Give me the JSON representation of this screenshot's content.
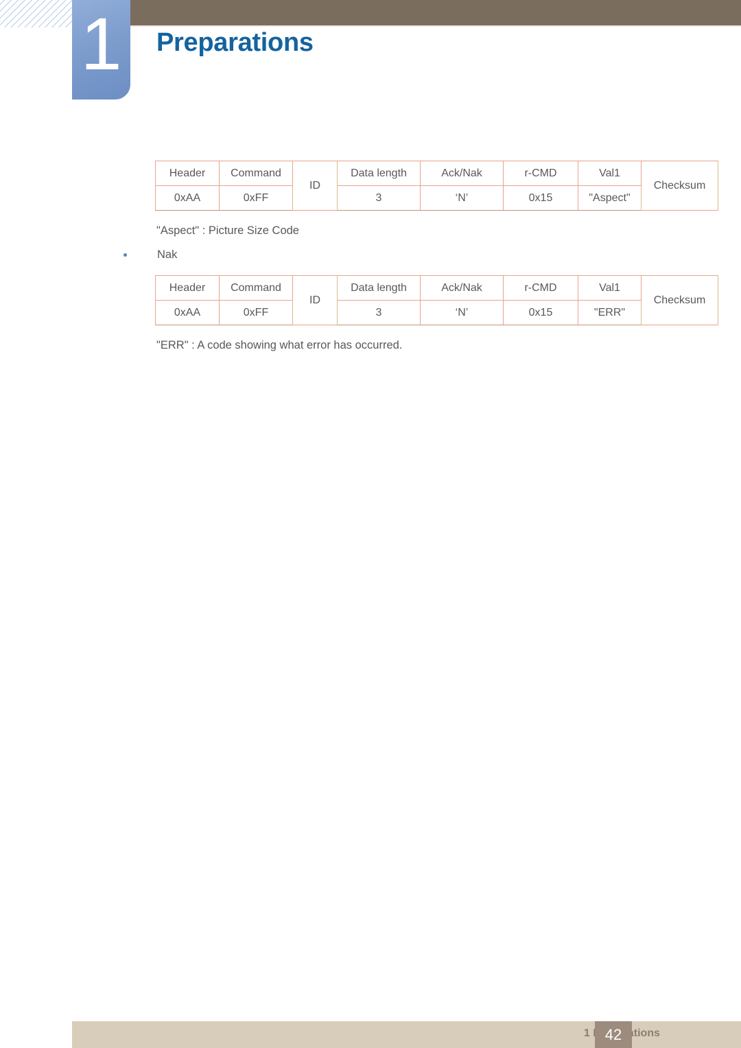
{
  "header": {
    "chapter_number": "1",
    "chapter_title": "Preparations",
    "bar_color": "#7a6d5e",
    "badge_color": "#7d9dcd",
    "title_color": "#14639f"
  },
  "tables": [
    {
      "name": "ack-response-table",
      "columns": [
        "Header",
        "Command",
        "ID",
        "Data length",
        "Ack/Nak",
        "r-CMD",
        "Val1",
        "Checksum"
      ],
      "values": [
        "0xAA",
        "0xFF",
        "ID",
        "3",
        "‘N’",
        "0x15",
        "\"Aspect\"",
        "Checksum"
      ],
      "rowspan_columns": [
        "ID",
        "Checksum"
      ]
    },
    {
      "name": "nak-response-table",
      "columns": [
        "Header",
        "Command",
        "ID",
        "Data length",
        "Ack/Nak",
        "r-CMD",
        "Val1",
        "Checksum"
      ],
      "values": [
        "0xAA",
        "0xFF",
        "ID",
        "3",
        "‘N’",
        "0x15",
        "\"ERR\"",
        "Checksum"
      ],
      "rowspan_columns": [
        "ID",
        "Checksum"
      ]
    }
  ],
  "notes": {
    "aspect_note": "\"Aspect\" : Picture Size Code",
    "nak_bullet": "Nak",
    "err_note": "\"ERR\" : A code showing what error has occurred."
  },
  "footer": {
    "section_label": "1 Preparations",
    "page_number": "42",
    "bar_color": "#d8cdbb",
    "page_box_color": "#9d8b7d"
  }
}
